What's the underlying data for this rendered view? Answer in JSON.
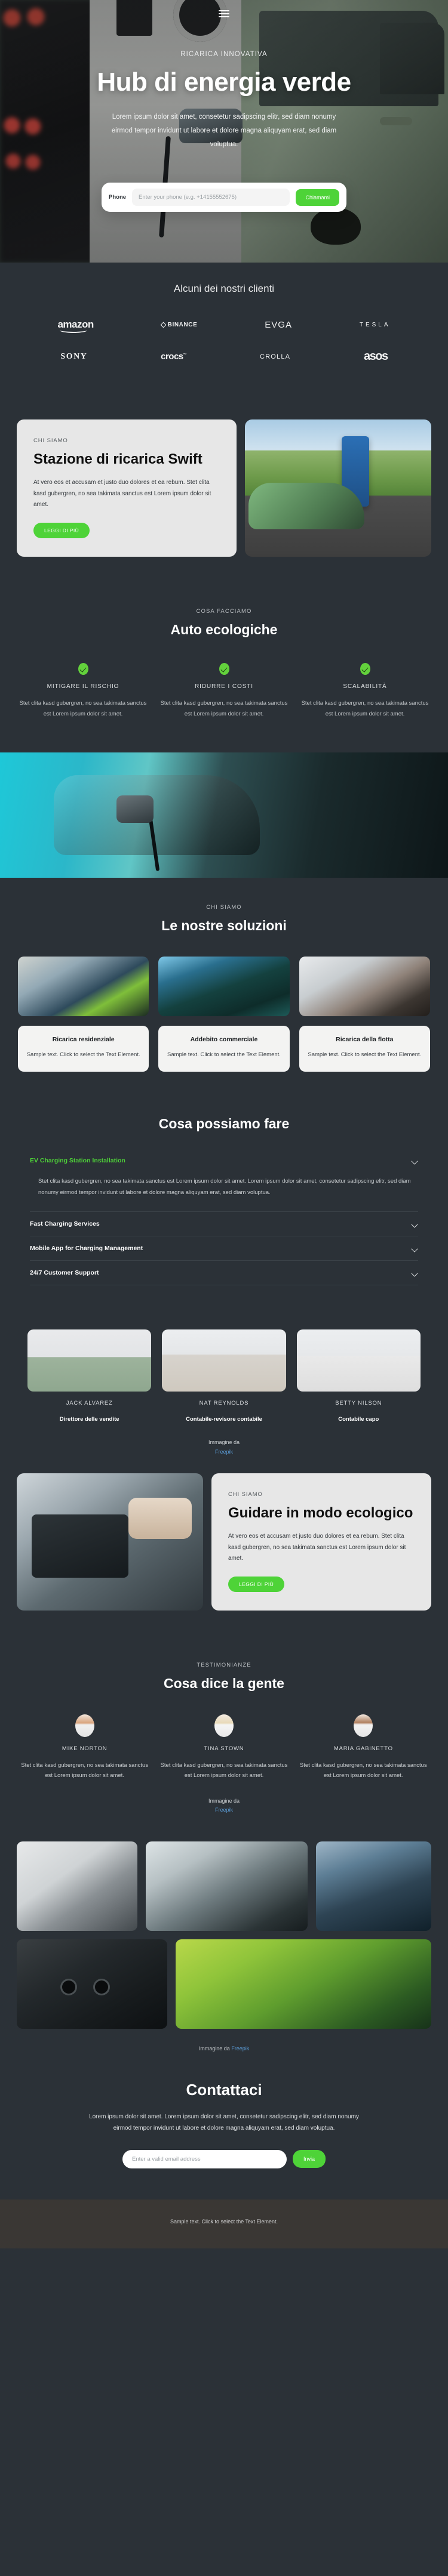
{
  "hero": {
    "eyebrow": "RICARICA INNOVATIVA",
    "title": "Hub di energia verde",
    "subtitle": "Lorem ipsum dolor sit amet, consetetur sadipscing elitr, sed diam nonumy eirmod tempor invidunt ut labore et dolore magna aliquyam erat, sed diam voluptua.",
    "form": {
      "label": "Phone",
      "placeholder": "Enter your phone (e.g. +14155552675)",
      "button": "Chiamami"
    },
    "menu_icon": "hamburger-menu-icon"
  },
  "clients": {
    "title": "Alcuni dei nostri clienti",
    "row1": [
      "amazon",
      "BINANCE",
      "EVGA",
      "TESLA"
    ],
    "row2": [
      "SONY",
      "crocs",
      "CROLLA",
      "asos"
    ]
  },
  "about": {
    "eyebrow": "CHI SIAMO",
    "title": "Stazione di ricarica Swift",
    "body": "At vero eos et accusam et justo duo dolores et ea rebum. Stet clita kasd gubergren, no sea takimata sanctus est Lorem ipsum dolor sit amet.",
    "button": "LEGGI DI PIÙ"
  },
  "features": {
    "eyebrow": "COSA FACCIAMO",
    "title": "Auto ecologiche",
    "items": [
      {
        "title": "MITIGARE IL RISCHIO",
        "body": "Stet clita kasd gubergren, no sea takimata sanctus est Lorem ipsum dolor sit amet."
      },
      {
        "title": "RIDURRE I COSTI",
        "body": "Stet clita kasd gubergren, no sea takimata sanctus est Lorem ipsum dolor sit amet."
      },
      {
        "title": "SCALABILITÀ",
        "body": "Stet clita kasd gubergren, no sea takimata sanctus est Lorem ipsum dolor sit amet."
      }
    ]
  },
  "solutions": {
    "eyebrow": "CHI SIAMO",
    "title": "Le nostre soluzioni",
    "cards": [
      {
        "title": "Ricarica residenziale",
        "body": "Sample text. Click to select the Text Element."
      },
      {
        "title": "Addebito commerciale",
        "body": "Sample text. Click to select the Text Element."
      },
      {
        "title": "Ricarica della flotta",
        "body": "Sample text. Click to select the Text Element."
      }
    ]
  },
  "accordion": {
    "title": "Cosa possiamo fare",
    "items": [
      {
        "title": "EV Charging Station Installation",
        "body": "Stet clita kasd gubergren, no sea takimata sanctus est Lorem ipsum dolor sit amet. Lorem ipsum dolor sit amet, consetetur sadipscing elitr, sed diam nonumy eirmod tempor invidunt ut labore et dolore magna aliquyam erat, sed diam voluptua.",
        "open": true
      },
      {
        "title": "Fast Charging Services",
        "body": "",
        "open": false
      },
      {
        "title": "Mobile App for Charging Management",
        "body": "",
        "open": false
      },
      {
        "title": "24/7 Customer Support",
        "body": "",
        "open": false
      }
    ],
    "chevron_icon": "chevron-down-icon"
  },
  "team": {
    "members": [
      {
        "name": "JACK ALVAREZ",
        "role": "Direttore delle vendite"
      },
      {
        "name": "NAT REYNOLDS",
        "role": "Contabile-revisore contabile"
      },
      {
        "name": "BETTY NILSON",
        "role": "Contabile capo"
      }
    ],
    "credit_prefix": "Immagine da",
    "credit_link": "Freepik"
  },
  "driving": {
    "eyebrow": "CHI SIAMO",
    "title": "Guidare in modo ecologico",
    "body": "At vero eos et accusam et justo duo dolores et ea rebum. Stet clita kasd gubergren, no sea takimata sanctus est Lorem ipsum dolor sit amet.",
    "button": "LEGGI DI PIÙ"
  },
  "testimonials": {
    "eyebrow": "TESTIMONIANZE",
    "title": "Cosa dice la gente",
    "items": [
      {
        "name": "MIKE NORTON",
        "body": "Stet clita kasd gubergren, no sea takimata sanctus est Lorem ipsum dolor sit amet."
      },
      {
        "name": "TINA STOWN",
        "body": "Stet clita kasd gubergren, no sea takimata sanctus est Lorem ipsum dolor sit amet."
      },
      {
        "name": "MARIA GABINETTO",
        "body": "Stet clita kasd gubergren, no sea takimata sanctus est Lorem ipsum dolor sit amet."
      }
    ],
    "credit_prefix": "Immagine da",
    "credit_link": "Freepik"
  },
  "gallery": {
    "credit_prefix": "Immagine da",
    "credit_link": "Freepik"
  },
  "contact": {
    "title": "Contattaci",
    "body": "Lorem ipsum dolor sit amet. Lorem ipsum dolor sit amet, consetetur sadipscing elitr, sed diam nonumy eirmod tempor invidunt ut labore et dolore magna aliquyam erat, sed diam voluptua.",
    "placeholder": "Enter a valid email address",
    "button": "Invia"
  },
  "footer": {
    "text": "Sample text. Click to select the Text Element."
  },
  "colors": {
    "accent": "#4ed338",
    "bg": "#2b3137",
    "card_light": "#e7e7e7",
    "footer_bg": "#3a3734",
    "link": "#5a9bd5"
  }
}
